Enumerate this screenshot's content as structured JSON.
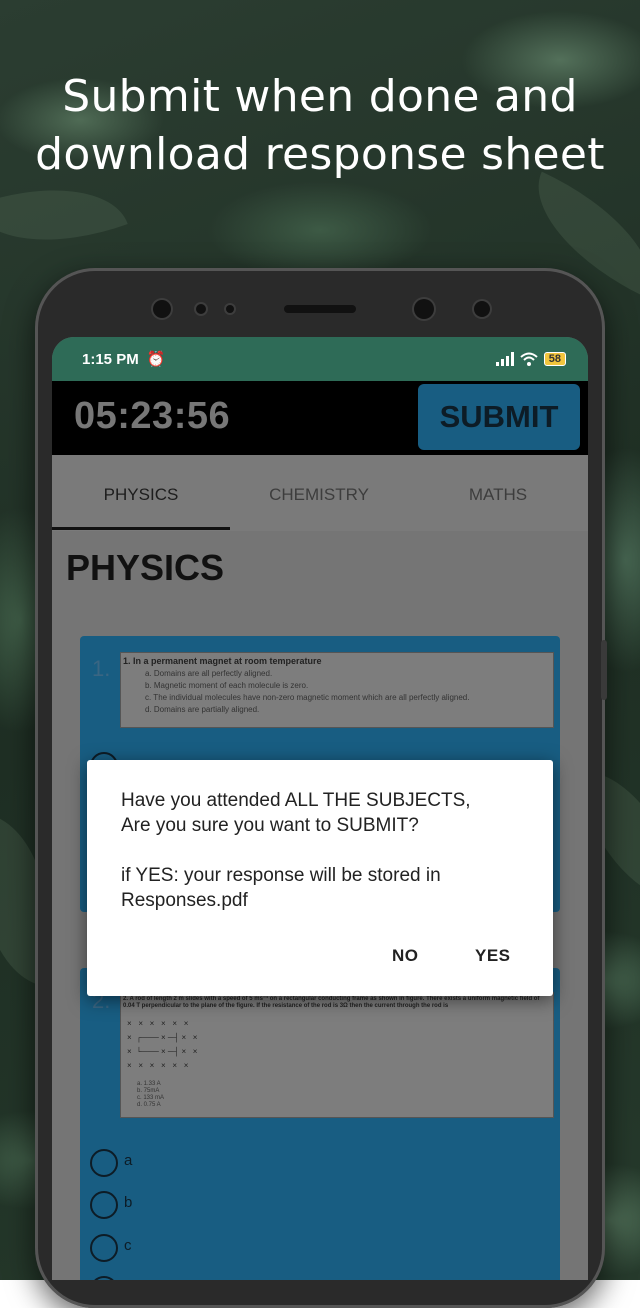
{
  "headline": {
    "line1": "Submit when done and",
    "line2": "download response sheet"
  },
  "status_bar": {
    "time": "1:15 PM",
    "battery": "58"
  },
  "top_bar": {
    "timer": "05:23:56",
    "submit_label": "SUBMIT"
  },
  "tabs": [
    {
      "label": "PHYSICS",
      "active": true
    },
    {
      "label": "CHEMISTRY",
      "active": false
    },
    {
      "label": "MATHS",
      "active": false
    }
  ],
  "section_title": "PHYSICS",
  "questions": [
    {
      "number": "1.",
      "text": "1. In a permanent magnet at room temperature",
      "options": [
        "a. Domains are all perfectly aligned.",
        "b. Magnetic moment of each molecule is zero.",
        "c. The individual molecules have non-zero magnetic moment which are all perfectly aligned.",
        "d. Domains are partially aligned."
      ]
    },
    {
      "number": "2.",
      "text": "2. A rod of length 2 m slides with a speed of 5 ms⁻¹ on a rectangular conducting frame as shown in figure. There exists a uniform magnetic field of 0.04 T perpendicular to the plane of the figure. If the resistance of the rod is 3Ω then the current through the rod is",
      "options": [
        "a. 1.33 A",
        "b. 75mA",
        "c. 133 mA",
        "d. 0.75 A"
      ],
      "answer_choices": [
        "a",
        "b",
        "c"
      ]
    }
  ],
  "dialog": {
    "line1": "Have you attended ALL THE SUBJECTS,",
    "line2": "Are you sure you want to SUBMIT?",
    "line3": "if YES: your response will be stored in",
    "line4": "Responses.pdf",
    "no_label": "NO",
    "yes_label": "YES"
  }
}
